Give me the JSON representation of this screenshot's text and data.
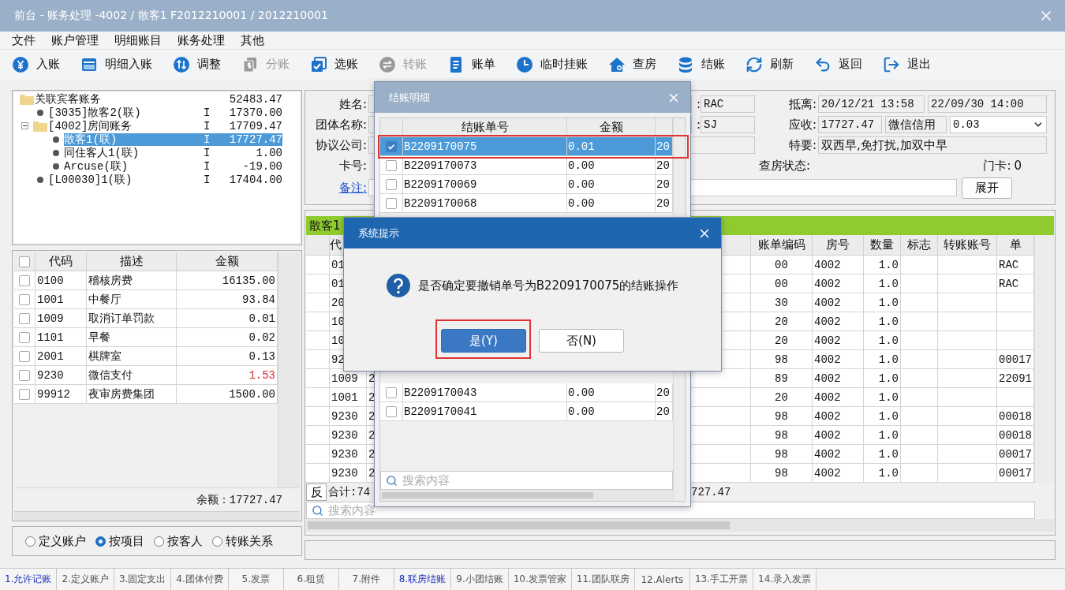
{
  "window": {
    "title": "前台 - 账务处理 -4002 / 散客1 F2012210001 / 2012210001"
  },
  "menu": [
    "文件",
    "账户管理",
    "明细账目",
    "账务处理",
    "其他"
  ],
  "toolbar": [
    {
      "label": "入账",
      "kind": "yen",
      "disabled": false
    },
    {
      "label": "明细入账",
      "kind": "card",
      "disabled": false
    },
    {
      "label": "调整",
      "kind": "updown",
      "disabled": false
    },
    {
      "label": "分账",
      "kind": "split",
      "disabled": true
    },
    {
      "label": "选账",
      "kind": "select",
      "disabled": false
    },
    {
      "label": "转账",
      "kind": "swap",
      "disabled": true
    },
    {
      "label": "账单",
      "kind": "bill",
      "disabled": false
    },
    {
      "label": "临时挂账",
      "kind": "clock",
      "disabled": false
    },
    {
      "label": "查房",
      "kind": "house",
      "disabled": false
    },
    {
      "label": "结账",
      "kind": "database",
      "disabled": false
    },
    {
      "label": "刷新",
      "kind": "refresh",
      "disabled": false
    },
    {
      "label": "返回",
      "kind": "undo",
      "disabled": false
    },
    {
      "label": "退出",
      "kind": "exit",
      "disabled": false
    }
  ],
  "account_tree": [
    {
      "kind": "folder",
      "label": "关联宾客账务",
      "amount": "52483.47",
      "selected": false,
      "children": [
        {
          "kind": "guest",
          "label": "[3035]散客2(联)",
          "flag": "I",
          "amount": "17370.00",
          "selected": false
        },
        {
          "kind": "folder",
          "label": "[4002]房间账务",
          "flag": "I",
          "amount": "17709.47",
          "expanded": true,
          "selected": false,
          "children": [
            {
              "kind": "guest",
              "label": "散客1(联)",
              "flag": "I",
              "amount": "17727.47",
              "selected": true
            },
            {
              "kind": "guest",
              "label": "同住客人1(联)",
              "flag": "I",
              "amount": "1.00",
              "selected": false
            },
            {
              "kind": "guest",
              "label": "Arcuse(联)",
              "flag": "I",
              "amount": "-19.00",
              "selected": false
            }
          ]
        },
        {
          "kind": "guest",
          "label": "[L00030]1(联)",
          "flag": "I",
          "amount": "17404.00",
          "selected": false
        }
      ]
    }
  ],
  "items_table": {
    "all_checked": false,
    "columns": [
      "代码",
      "描述",
      "金额"
    ],
    "rows": [
      {
        "code": "0100",
        "description": "稽核房费",
        "amount": "16135.00",
        "checked": false,
        "alert": false
      },
      {
        "code": "1001",
        "description": "中餐厅",
        "amount": "93.84",
        "checked": false,
        "alert": false
      },
      {
        "code": "1009",
        "description": "取消订单罚款",
        "amount": "0.01",
        "checked": false,
        "alert": false
      },
      {
        "code": "1101",
        "description": "早餐",
        "amount": "0.02",
        "checked": false,
        "alert": false
      },
      {
        "code": "2001",
        "description": "棋牌室",
        "amount": "0.13",
        "checked": false,
        "alert": false
      },
      {
        "code": "9230",
        "description": "微信支付",
        "amount": "1.53",
        "checked": false,
        "alert": true
      },
      {
        "code": "99912",
        "description": "夜审房费集团",
        "amount": "1500.00",
        "checked": false,
        "alert": false
      }
    ]
  },
  "balance": "余额：17727.47",
  "view_options": [
    {
      "label": "定义账户",
      "selected": false
    },
    {
      "label": "按项目",
      "selected": true
    },
    {
      "label": "按客人",
      "selected": false
    },
    {
      "label": "转账关系",
      "selected": false
    }
  ],
  "guest_info": {
    "name_label": "姓名:",
    "group_label": "团体名称:",
    "company_label": "协议公司:",
    "card_label": "卡号:",
    "remark_link": "备注:",
    "room_rate_label_end": ":",
    "room_rate": "RAC",
    "source_label_end": ":",
    "source": "SJ",
    "stay_label": "抵离:",
    "arrival": "20/12/21 13:58",
    "departure": "22/09/30 14:00",
    "receivable_label": "应收:",
    "receivable": "17727.47",
    "payment_method": "微信信用",
    "payment_amount": "0.03",
    "requests_label": "特要:",
    "requests": "双西早,免打扰,加双中早",
    "inspection_label": "查房状态:",
    "keycard_label": "门卡:",
    "keycard": "0",
    "expand_button": "展开"
  },
  "ledger": {
    "tab": "散客1",
    "columns": [
      "代",
      "账单编码",
      "房号",
      "数量",
      "标志",
      "转账账号",
      "单"
    ],
    "rows": [
      {
        "code": "01",
        "bill_code": "00",
        "room": "4002",
        "quantity": "1.0",
        "unit": "RAC"
      },
      {
        "code": "01",
        "bill_code": "00",
        "room": "4002",
        "quantity": "1.0",
        "unit": "RAC"
      },
      {
        "code": "20",
        "bill_code": "30",
        "room": "4002",
        "quantity": "1.0"
      },
      {
        "code": "10",
        "bill_code": "20",
        "room": "4002",
        "quantity": "1.0"
      },
      {
        "code": "10",
        "bill_code": "20",
        "room": "4002",
        "quantity": "1.0"
      },
      {
        "code": "92",
        "bill_code": "98",
        "room": "4002",
        "quantity": "1.0",
        "unit": "00017"
      },
      {
        "code": "1009",
        "column_2": "2",
        "bill_code": "89",
        "room": "4002",
        "quantity": "1.0",
        "unit": "22091"
      },
      {
        "code": "1001",
        "column_2": "2",
        "bill_code": "20",
        "room": "4002",
        "quantity": "1.0"
      },
      {
        "code": "9230",
        "column_2": "2",
        "bill_code": "98",
        "room": "4002",
        "quantity": "1.0",
        "unit": "00018"
      },
      {
        "code": "9230",
        "column_2": "2",
        "bill_code": "98",
        "room": "4002",
        "quantity": "1.0",
        "unit": "00018"
      },
      {
        "code": "9230",
        "column_2": "2",
        "bill_code": "98",
        "room": "4002",
        "quantity": "1.0",
        "unit": "00017"
      },
      {
        "code": "9230",
        "column_2": "2",
        "bill_code": "98",
        "room": "4002",
        "quantity": "1.0",
        "unit": "00017"
      }
    ],
    "reverse_button": "反",
    "total": "合计:74",
    "total_amount": "727.47",
    "search_placeholder": "搜索内容"
  },
  "settlement_dialog": {
    "title": "结账明细",
    "columns": [
      "结账单号",
      "金额"
    ],
    "rows_top": [
      {
        "number": "B2209170075",
        "amount": "0.01",
        "column_3": "20",
        "checked": true,
        "selected": true,
        "highlighted": true
      },
      {
        "number": "B2209170073",
        "amount": "0.00",
        "column_3": "20",
        "checked": false,
        "selected": false,
        "highlighted": false
      },
      {
        "number": "B2209170069",
        "amount": "0.00",
        "column_3": "20",
        "checked": false,
        "selected": false,
        "highlighted": false
      },
      {
        "number": "B2209170068",
        "amount": "0.00",
        "column_3": "20",
        "checked": false,
        "selected": false,
        "highlighted": false
      }
    ],
    "rows_bottom": [
      {
        "number": "B2209170043",
        "amount": "0.00",
        "column_3": "20",
        "checked": false,
        "selected": false,
        "highlighted": false
      },
      {
        "number": "B2209170041",
        "amount": "0.00",
        "column_3": "20",
        "checked": false,
        "selected": false,
        "highlighted": false
      }
    ],
    "search_placeholder": "搜索内容"
  },
  "confirm_dialog": {
    "title": "系统提示",
    "message": "是否确定要撤销单号为B2209170075的结账操作",
    "buttons": [
      {
        "label": "是(Y)",
        "selected": true,
        "highlighted": true
      },
      {
        "label": "否(N)",
        "selected": false,
        "highlighted": false
      }
    ]
  },
  "bottom_tabs": [
    {
      "label": "1.允许记账",
      "selected": true
    },
    {
      "label": "2.定义账户",
      "selected": false
    },
    {
      "label": "3.固定支出",
      "selected": false
    },
    {
      "label": "4.团体付费",
      "selected": false
    },
    {
      "label": "5.发票",
      "selected": false
    },
    {
      "label": "6.租赁",
      "selected": false
    },
    {
      "label": "7.附件",
      "selected": false
    },
    {
      "label": "8.联房结账",
      "selected": true
    },
    {
      "label": "9.小团结账",
      "selected": false
    },
    {
      "label": "10.发票管家",
      "selected": false
    },
    {
      "label": "11.团队联房",
      "selected": false
    },
    {
      "label": "12.Alerts",
      "selected": false
    },
    {
      "label": "13.手工开票",
      "selected": false
    },
    {
      "label": "14.录入发票",
      "selected": false
    }
  ]
}
